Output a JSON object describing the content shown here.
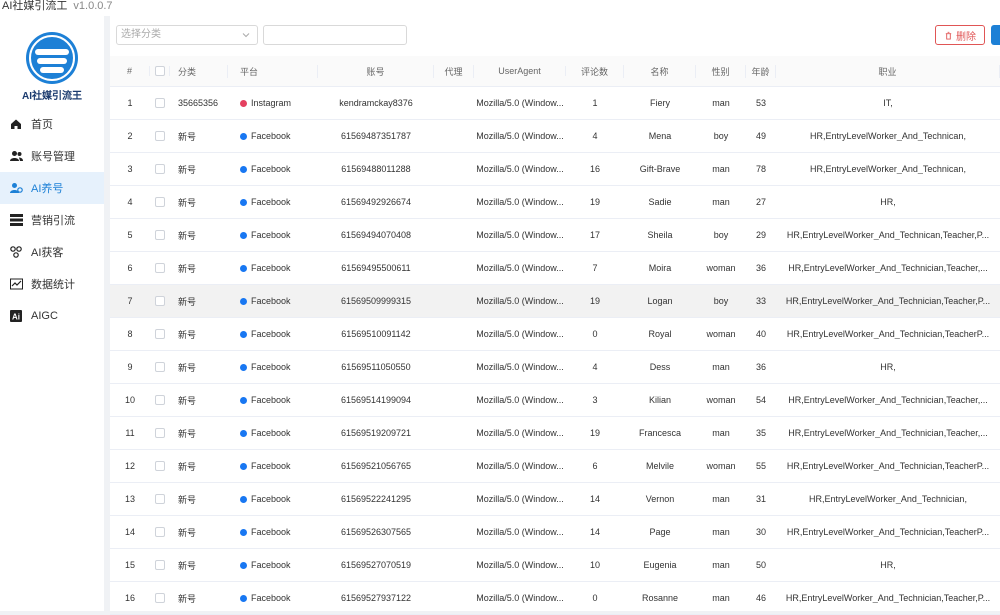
{
  "window": {
    "title": "AI社媒引流工",
    "version": "v1.0.0.7"
  },
  "sidebar": {
    "brand": "AI社媒引流王",
    "items": [
      {
        "label": "首页",
        "icon": "home-icon",
        "active": false
      },
      {
        "label": "账号管理",
        "icon": "users-icon",
        "active": false
      },
      {
        "label": "AI养号",
        "icon": "user-ai-icon",
        "active": true
      },
      {
        "label": "营销引流",
        "icon": "server-icon",
        "active": false
      },
      {
        "label": "AI获客",
        "icon": "hub-icon",
        "active": false
      },
      {
        "label": "数据统计",
        "icon": "chart-icon",
        "active": false
      },
      {
        "label": "AIGC",
        "icon": "ai-icon",
        "active": false
      }
    ]
  },
  "toolbar": {
    "select_placeholder": "选择分类",
    "search_value": "",
    "delete_label": "删除"
  },
  "table": {
    "headers": [
      "#",
      "",
      "分类",
      "平台",
      "账号",
      "代理",
      "UserAgent",
      "评论数",
      "名称",
      "性别",
      "年龄",
      "职业"
    ],
    "rows": [
      {
        "idx": "1",
        "group": "35665356",
        "platform": "Instagram",
        "platform_type": "ig",
        "account": "kendramckay8376",
        "proxy": "",
        "ua": "Mozilla/5.0 (Window...",
        "count": "1",
        "name": "Fiery",
        "gender": "man",
        "age": "53",
        "job": "IT,"
      },
      {
        "idx": "2",
        "group": "新号",
        "platform": "Facebook",
        "platform_type": "fb",
        "account": "61569487351787",
        "proxy": "",
        "ua": "Mozilla/5.0 (Window...",
        "count": "4",
        "name": "Mena",
        "gender": "boy",
        "age": "49",
        "job": "HR,EntryLevelWorker_And_Technican,"
      },
      {
        "idx": "3",
        "group": "新号",
        "platform": "Facebook",
        "platform_type": "fb",
        "account": "61569488011288",
        "proxy": "",
        "ua": "Mozilla/5.0 (Window...",
        "count": "16",
        "name": "Gift-Brave",
        "gender": "man",
        "age": "78",
        "job": "HR,EntryLevelWorker_And_Technican,"
      },
      {
        "idx": "4",
        "group": "新号",
        "platform": "Facebook",
        "platform_type": "fb",
        "account": "61569492926674",
        "proxy": "",
        "ua": "Mozilla/5.0 (Window...",
        "count": "19",
        "name": "Sadie",
        "gender": "man",
        "age": "27",
        "job": "HR,"
      },
      {
        "idx": "5",
        "group": "新号",
        "platform": "Facebook",
        "platform_type": "fb",
        "account": "61569494070408",
        "proxy": "",
        "ua": "Mozilla/5.0 (Window...",
        "count": "17",
        "name": "Sheila",
        "gender": "boy",
        "age": "29",
        "job": "HR,EntryLevelWorker_And_Technican,Teacher,P..."
      },
      {
        "idx": "6",
        "group": "新号",
        "platform": "Facebook",
        "platform_type": "fb",
        "account": "61569495500611",
        "proxy": "",
        "ua": "Mozilla/5.0 (Window...",
        "count": "7",
        "name": "Moira",
        "gender": "woman",
        "age": "36",
        "job": "HR,EntryLevelWorker_And_Technician,Teacher,..."
      },
      {
        "idx": "7",
        "group": "新号",
        "platform": "Facebook",
        "platform_type": "fb",
        "account": "61569509999315",
        "proxy": "",
        "ua": "Mozilla/5.0 (Window...",
        "count": "19",
        "name": "Logan",
        "gender": "boy",
        "age": "33",
        "job": "HR,EntryLevelWorker_And_Technician,Teacher,P..."
      },
      {
        "idx": "8",
        "group": "新号",
        "platform": "Facebook",
        "platform_type": "fb",
        "account": "61569510091142",
        "proxy": "",
        "ua": "Mozilla/5.0 (Window...",
        "count": "0",
        "name": "Royal",
        "gender": "woman",
        "age": "40",
        "job": "HR,EntryLevelWorker_And_Technician,TeacherP..."
      },
      {
        "idx": "9",
        "group": "新号",
        "platform": "Facebook",
        "platform_type": "fb",
        "account": "61569511050550",
        "proxy": "",
        "ua": "Mozilla/5.0 (Window...",
        "count": "4",
        "name": "Dess",
        "gender": "man",
        "age": "36",
        "job": "HR,"
      },
      {
        "idx": "10",
        "group": "新号",
        "platform": "Facebook",
        "platform_type": "fb",
        "account": "61569514199094",
        "proxy": "",
        "ua": "Mozilla/5.0 (Window...",
        "count": "3",
        "name": "Kilian",
        "gender": "woman",
        "age": "54",
        "job": "HR,EntryLevelWorker_And_Technician,Teacher,..."
      },
      {
        "idx": "11",
        "group": "新号",
        "platform": "Facebook",
        "platform_type": "fb",
        "account": "61569519209721",
        "proxy": "",
        "ua": "Mozilla/5.0 (Window...",
        "count": "19",
        "name": "Francesca",
        "gender": "man",
        "age": "35",
        "job": "HR,EntryLevelWorker_And_Technician,Teacher,..."
      },
      {
        "idx": "12",
        "group": "新号",
        "platform": "Facebook",
        "platform_type": "fb",
        "account": "61569521056765",
        "proxy": "",
        "ua": "Mozilla/5.0 (Window...",
        "count": "6",
        "name": "Melvile",
        "gender": "woman",
        "age": "55",
        "job": "HR,EntryLevelWorker_And_Technician,TeacherP..."
      },
      {
        "idx": "13",
        "group": "新号",
        "platform": "Facebook",
        "platform_type": "fb",
        "account": "61569522241295",
        "proxy": "",
        "ua": "Mozilla/5.0 (Window...",
        "count": "14",
        "name": "Vernon",
        "gender": "man",
        "age": "31",
        "job": "HR,EntryLevelWorker_And_Technician,"
      },
      {
        "idx": "14",
        "group": "新号",
        "platform": "Facebook",
        "platform_type": "fb",
        "account": "61569526307565",
        "proxy": "",
        "ua": "Mozilla/5.0 (Window...",
        "count": "14",
        "name": "Page",
        "gender": "man",
        "age": "30",
        "job": "HR,EntryLevelWorker_And_Technician,TeacherP..."
      },
      {
        "idx": "15",
        "group": "新号",
        "platform": "Facebook",
        "platform_type": "fb",
        "account": "61569527070519",
        "proxy": "",
        "ua": "Mozilla/5.0 (Window...",
        "count": "10",
        "name": "Eugenia",
        "gender": "man",
        "age": "50",
        "job": "HR,"
      },
      {
        "idx": "16",
        "group": "新号",
        "platform": "Facebook",
        "platform_type": "fb",
        "account": "61569527937122",
        "proxy": "",
        "ua": "Mozilla/5.0 (Window...",
        "count": "0",
        "name": "Rosanne",
        "gender": "man",
        "age": "46",
        "job": "HR,EntryLevelWorker_And_Technician,Teacher,P..."
      }
    ],
    "highlight_row": 6
  },
  "colors": {
    "accent": "#1d80d6",
    "danger": "#e05555",
    "facebook": "#1877f2",
    "instagram": "#e4405f"
  }
}
